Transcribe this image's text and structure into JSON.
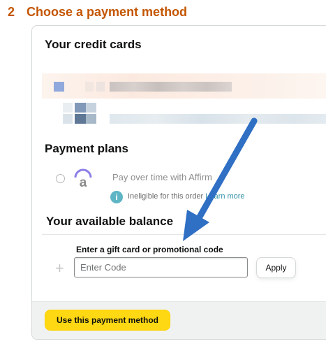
{
  "step": {
    "number": "2",
    "title": "Choose a payment method",
    "color": "#c45500"
  },
  "sections": {
    "credit_cards_title": "Your credit cards",
    "payment_plans_title": "Payment plans",
    "balance_title": "Your available balance"
  },
  "affirm": {
    "option_label": "Pay over time with Affirm",
    "ineligible_text": "Ineligible for this order",
    "learn_more": "Learn more",
    "logo_glyph": "a",
    "info_glyph": "i"
  },
  "gift_card": {
    "label": "Enter a gift card or promotional code",
    "placeholder": "Enter Code",
    "value": "",
    "apply_label": "Apply",
    "plus_glyph": "+"
  },
  "footer": {
    "use_button_label": "Use this payment method"
  },
  "colors": {
    "accent": "#c45500",
    "primary_button": "#ffd814",
    "annotation_arrow": "#2f6fc4",
    "link": "#2f8fa7"
  },
  "icons": [
    "radio-icon",
    "affirm-logo-icon",
    "info-icon",
    "plus-icon",
    "annotation-arrow"
  ]
}
